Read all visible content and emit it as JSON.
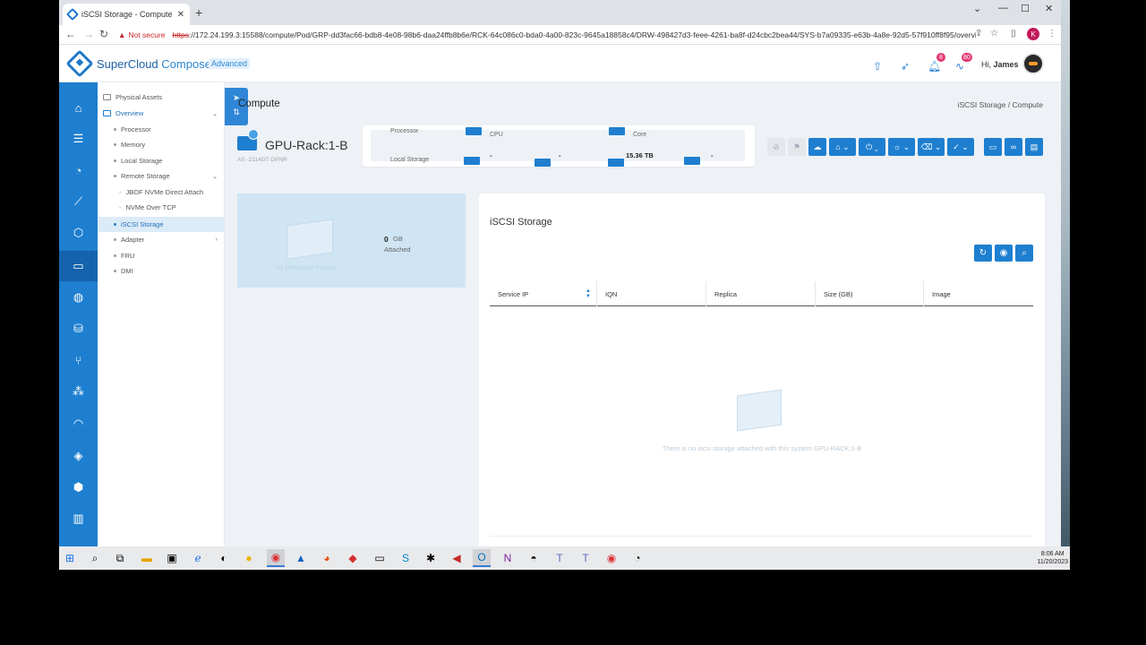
{
  "browser": {
    "tab_title": "iSCSI Storage - Compute - Supe",
    "url_not_secure": "Not secure",
    "url_scheme": "https",
    "url_rest": "://172.24.199.3:15588/compute/Pod/GRP-dd3fac66-bdb8-4e08-98b6-daa24ffb8b6e/RCK-64c086c0-bda0-4a00-823c-9645a18858c4/DRW-498427d3-feee-4261-ba8f-d24cbc2bea44/SYS-b7a09335-e63b-4a8e-92d5-57f910ff8f95/overview...",
    "profile_initial": "K"
  },
  "app": {
    "brand_a": "SuperCloud ",
    "brand_b": "Composer",
    "edition": "Advanced",
    "notif_badge": "8",
    "activity_badge": "80",
    "greeting": "Hi, ",
    "user": "James"
  },
  "sidebar": {
    "items": [
      {
        "label": "Physical Assets"
      },
      {
        "label": "Overview"
      },
      {
        "label": "Processor"
      },
      {
        "label": "Memory"
      },
      {
        "label": "Local Storage"
      },
      {
        "label": "Remote Storage"
      },
      {
        "label": "JBOF NVMe Direct Attach"
      },
      {
        "label": "NVMe Over TCP"
      },
      {
        "label": "iSCSI Storage"
      },
      {
        "label": "Adapter"
      },
      {
        "label": "FRU"
      },
      {
        "label": "DMI"
      }
    ]
  },
  "page": {
    "title": "Compute",
    "breadcrumb": "iSCSI Storage / Compute",
    "rack_name": "GPU-Rack:1-B",
    "rack_model": "AS -2114GT-DPNR"
  },
  "specs": {
    "processor": "Processor",
    "cpu": "CPU",
    "core": "Core",
    "local_storage": "Local Storage",
    "val1": "-",
    "val2": "-",
    "val3": "15.36 TB",
    "val4": "-"
  },
  "resource": {
    "no_resource": "No Resource Found",
    "gb_value": "0",
    "gb_unit": "GB",
    "attached": "Attached"
  },
  "iscsi": {
    "title": "iSCSI Storage",
    "columns": [
      "Service IP",
      "IQN",
      "Replica",
      "Size (GB)",
      "Image"
    ],
    "empty_message": "There is no iscsi storage attached with this system GPU-RACK:1-B"
  },
  "taskbar": {
    "time": "8:06 AM",
    "date": "11/20/2023"
  },
  "colors": {
    "accent": "#1e7fd0",
    "rail": "#1e7fd0",
    "selected": "#dcebf8"
  }
}
